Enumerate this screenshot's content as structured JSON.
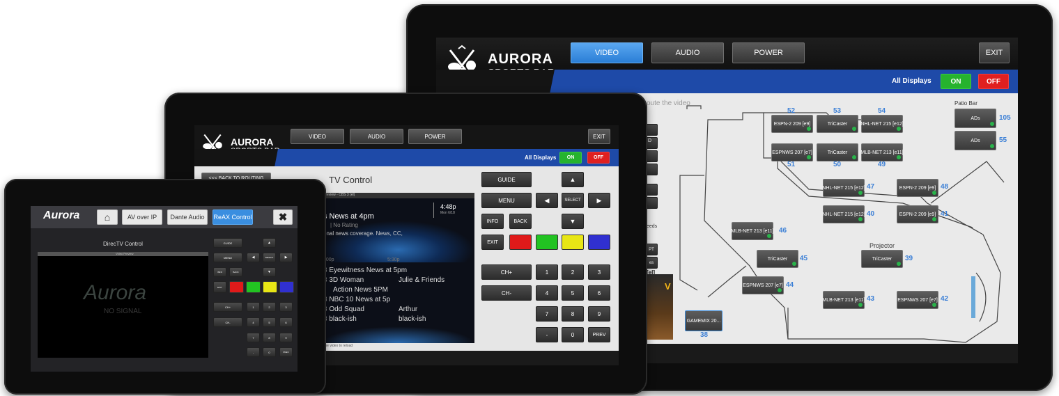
{
  "colors": {
    "accent_blue": "#1e4aa8",
    "on_green": "#26b32e",
    "off_red": "#e02020",
    "tab_blue": "#3a8ee0",
    "map_number": "#3b7fd6"
  },
  "large": {
    "brand": "AURORA",
    "brand_sub": "SPORTS BAR",
    "tabs": [
      "VIDEO",
      "AUDIO",
      "POWER"
    ],
    "exit": "EXIT",
    "all_displays": "All Displays",
    "on": "ON",
    "off": "OFF",
    "route_hint": "oute the video",
    "patio_bar": "Patio Bar",
    "projector": "Projector",
    "partial_text_1": "eeds",
    "partial_text_2": "[el]",
    "partial_text_3": "PT",
    "partial_text_4": "es",
    "partial_text_5": "D",
    "partial_text_6": "V",
    "displays": [
      {
        "label": "ESPN-2 209 [e9]",
        "num": "52"
      },
      {
        "label": "TriCaster",
        "num": "53"
      },
      {
        "label": "NHL-NET 215 [e12]",
        "num": "54"
      },
      {
        "label": "ESPNWS 207 [e7]",
        "num": "51"
      },
      {
        "label": "TriCaster",
        "num": "50"
      },
      {
        "label": "MLB-NET 213 [e11]",
        "num": "49"
      },
      {
        "label": "NHL-NET 215 [e12]",
        "num": "47"
      },
      {
        "label": "ESPN-2 209 [e9]",
        "num": "48"
      },
      {
        "label": "NHL-NET 215 [e12]",
        "num": "40"
      },
      {
        "label": "ESPN-2 209 [e9]",
        "num": "41"
      },
      {
        "label": "MLB-NET 213 [e11]",
        "num": "46"
      },
      {
        "label": "TriCaster",
        "num": "45"
      },
      {
        "label": "TriCaster",
        "num": "39"
      },
      {
        "label": "ESPNWS 207 [e7]",
        "num": "44"
      },
      {
        "label": "MLB-NET 213 [e11]",
        "num": "43"
      },
      {
        "label": "ESPNWS 207 [e7]",
        "num": "42"
      },
      {
        "label": "ADs",
        "num": "105"
      },
      {
        "label": "ADs",
        "num": "55"
      },
      {
        "label": "GAMEMIX 20...",
        "num": "38"
      }
    ]
  },
  "medium": {
    "brand": "AURORA",
    "brand_sub": "SPORTS BAR",
    "tabs": [
      "VIDEO",
      "AUDIO",
      "POWER"
    ],
    "exit": "EXIT",
    "all_displays": "All Displays",
    "on": "ON",
    "off": "OFF",
    "back": "<<< BACK TO ROUTING",
    "title": "TV Control",
    "preview_label": "Preview - CBS 3 (el)",
    "show": "s News at 4pm",
    "rating": "| No Rating",
    "desc": "onal news coverage. News, CC,",
    "time": "4:48p",
    "date": "Mon 6/18",
    "time_marks": [
      "5:00p",
      "5:30p"
    ],
    "guide_rows": [
      [
        "Eyewitness News at 5pm",
        ""
      ],
      [
        "3D Woman",
        "Julie & Friends"
      ],
      [
        "Action News 5PM",
        ""
      ],
      [
        "NBC 10 News at 5p",
        ""
      ],
      [
        "Odd Squad",
        "Arthur"
      ],
      [
        "black-ish",
        "black-ish"
      ]
    ],
    "footer": "the video to reload",
    "keys": {
      "guide": "GUIDE",
      "menu": "MENU",
      "select": "SELECT",
      "info": "INFO",
      "back": "BACK",
      "exit": "EXIT",
      "chup": "CH+",
      "chdn": "CH-",
      "prev": "PREV",
      "dash": "-",
      "digits": [
        "1",
        "2",
        "3",
        "4",
        "5",
        "6",
        "7",
        "8",
        "9",
        "0"
      ]
    }
  },
  "small": {
    "logo": "Aurora",
    "tabs": [
      "AV over IP",
      "Dante Audio",
      "ReAX Control"
    ],
    "title": "DirecTV Control",
    "preview": "Video Preview",
    "watermark": "Aurora",
    "no_signal": "NO SIGNAL",
    "keys": {
      "guide": "GUIDE",
      "menu": "MENU",
      "select": "SELECT",
      "info": "INFO",
      "back": "BACK",
      "exit": "EXIT",
      "chup": "CH+",
      "chdn": "CH-",
      "prev": "PREV",
      "dash": "-",
      "digits": [
        "1",
        "2",
        "3",
        "4",
        "5",
        "6",
        "7",
        "8",
        "9",
        "0"
      ]
    }
  }
}
